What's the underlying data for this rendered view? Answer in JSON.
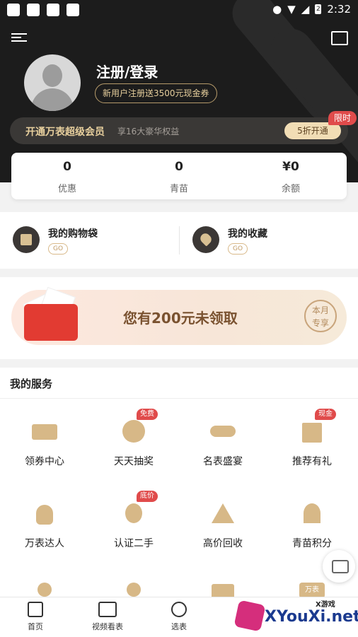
{
  "status_bar": {
    "time": "2:32",
    "battery": "2"
  },
  "header": {
    "login_label": "注册/登录",
    "coupon_text": "新用户注册送3500元现金券",
    "vip": {
      "title": "开通万表超级会员",
      "subtitle": "享16大豪华权益",
      "button": "5折开通",
      "badge": "限时"
    }
  },
  "stats": [
    {
      "value": "0",
      "label": "优惠"
    },
    {
      "value": "0",
      "label": "青苗"
    },
    {
      "value": "¥0",
      "label": "余额"
    }
  ],
  "quick_links": [
    {
      "label": "我的购物袋",
      "go": "GO"
    },
    {
      "label": "我的收藏",
      "go": "GO"
    }
  ],
  "promo": {
    "note_value": "200",
    "text": "您有200元未领取",
    "stamp_line1": "本月",
    "stamp_line2": "专享"
  },
  "services": {
    "title": "我的服务",
    "items": [
      {
        "label": "领券中心",
        "badge": ""
      },
      {
        "label": "天天抽奖",
        "badge": "免费"
      },
      {
        "label": "名表盛宴",
        "badge": ""
      },
      {
        "label": "推荐有礼",
        "badge": "现金"
      },
      {
        "label": "万表达人",
        "badge": ""
      },
      {
        "label": "认证二手",
        "badge": "底价"
      },
      {
        "label": "高价回收",
        "badge": ""
      },
      {
        "label": "青苗积分",
        "badge": ""
      }
    ],
    "partial_badge": "万表"
  },
  "tabbar": {
    "items": [
      {
        "label": "首页"
      },
      {
        "label": "视频看表"
      },
      {
        "label": "选表"
      }
    ]
  },
  "watermark": {
    "text": "XYouXi.net",
    "small": "X游戏"
  },
  "colors": {
    "gold": "#d7b887",
    "dark": "#1c1c1c",
    "red": "#e04b4b"
  }
}
